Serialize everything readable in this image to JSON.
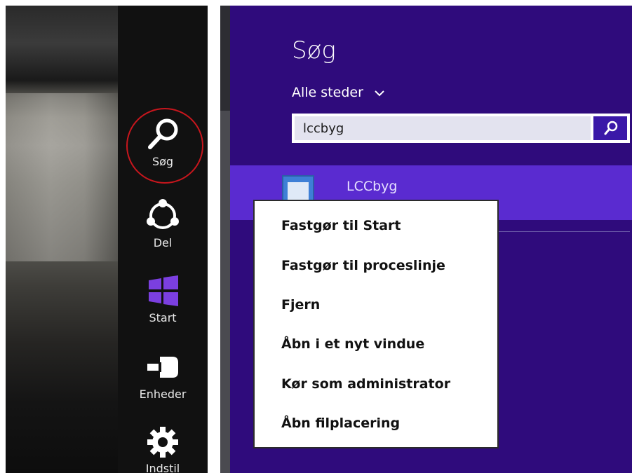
{
  "charms": {
    "items": [
      {
        "label": "Søg",
        "icon": "search-icon"
      },
      {
        "label": "Del",
        "icon": "share-icon"
      },
      {
        "label": "Start",
        "icon": "windows-logo-icon"
      },
      {
        "label": "Enheder",
        "icon": "devices-icon"
      },
      {
        "label": "Indstil",
        "icon": "gear-icon"
      }
    ],
    "highlight_color": "#c8161d"
  },
  "search_pane": {
    "title": "Søg",
    "scope": "Alle steder",
    "query": "lccbyg",
    "background": "#2f0b7c",
    "accent": "#5a2bd0"
  },
  "results": [
    {
      "label": "LCCbyg",
      "icon": "app-window-icon"
    }
  ],
  "context_menu": {
    "items": [
      "Fastgør til Start",
      "Fastgør til proceslinje",
      "Fjern",
      "Åbn i et nyt vindue",
      "Kør som administrator",
      "Åbn filplacering"
    ]
  }
}
